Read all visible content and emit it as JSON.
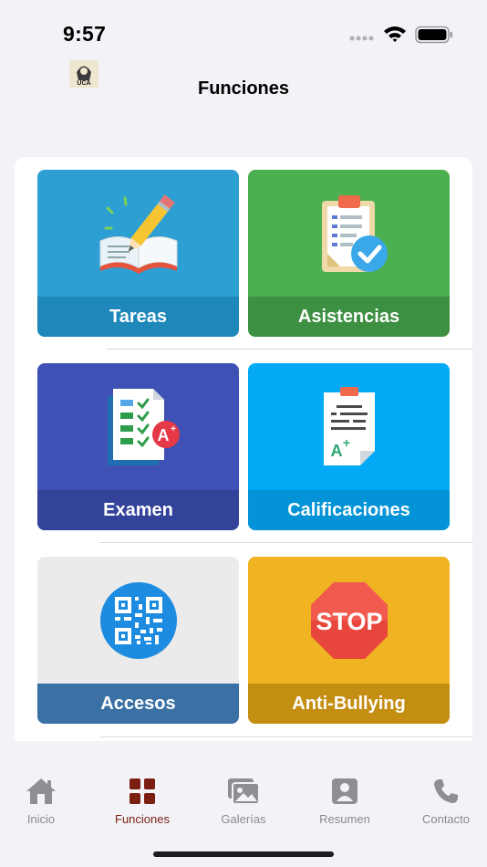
{
  "status_bar": {
    "time": "9:57"
  },
  "header": {
    "title": "Funciones",
    "logo_text": "UCA"
  },
  "tiles": [
    {
      "label": "Tareas",
      "color": "#2d9fd2",
      "band_color": "#1e88bb",
      "icon": "book-pencil-icon"
    },
    {
      "label": "Asistencias",
      "color": "#4caf50",
      "band_color": "#3d8f41",
      "icon": "clipboard-check-icon"
    },
    {
      "label": "Examen",
      "color": "#3f51b5",
      "band_color": "#33439a",
      "icon": "exam-grade-icon"
    },
    {
      "label": "Calificaciones",
      "color": "#03a9f4",
      "band_color": "#0393d6",
      "icon": "report-card-icon"
    },
    {
      "label": "Accesos",
      "color": "#ebebeb",
      "band_color": "#3a70a4",
      "icon": "qr-code-icon"
    },
    {
      "label": "Anti-Bullying",
      "color": "#f0b321",
      "band_color": "#c48e12",
      "icon": "stop-sign-icon"
    }
  ],
  "tab_bar": {
    "items": [
      {
        "label": "Inicio",
        "icon": "home-icon",
        "active": false
      },
      {
        "label": "Funciones",
        "icon": "grid-icon",
        "active": true
      },
      {
        "label": "Galerías",
        "icon": "gallery-icon",
        "active": false
      },
      {
        "label": "Resumen",
        "icon": "profile-icon",
        "active": false
      },
      {
        "label": "Contacto",
        "icon": "phone-icon",
        "active": false
      }
    ],
    "active_color": "#7b1f12",
    "inactive_color": "#8a8a8e"
  }
}
